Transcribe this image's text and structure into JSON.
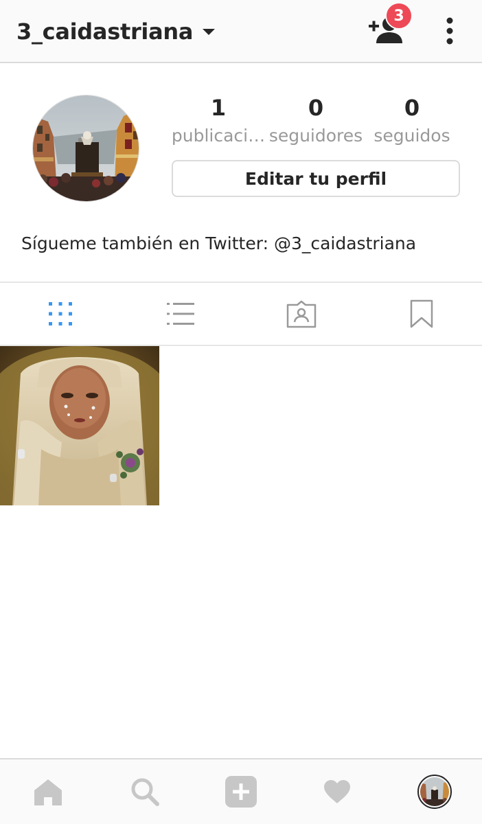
{
  "header": {
    "username": "3_caidastriana",
    "notification_count": "3",
    "icons": [
      "chevron-down-icon",
      "add-user-icon",
      "more-vertical-icon"
    ]
  },
  "profile": {
    "stats": [
      {
        "value": "1",
        "label": "publicaciones",
        "label_display": "publicaci…"
      },
      {
        "value": "0",
        "label": "seguidores"
      },
      {
        "value": "0",
        "label": "seguidos"
      }
    ],
    "edit_label": "Editar tu perfil",
    "bio": "Sígueme también en Twitter: @3_caidastriana"
  },
  "tabs": [
    {
      "icon": "grid-icon",
      "active": true
    },
    {
      "icon": "list-icon",
      "active": false
    },
    {
      "icon": "tagged-icon",
      "active": false
    },
    {
      "icon": "bookmark-icon",
      "active": false
    }
  ],
  "posts": [
    {
      "icon": "post-image"
    }
  ],
  "bottom_nav": [
    {
      "icon": "home-icon"
    },
    {
      "icon": "search-icon"
    },
    {
      "icon": "add-post-icon"
    },
    {
      "icon": "heart-icon"
    },
    {
      "icon": "profile-avatar"
    }
  ],
  "colors": {
    "accent": "#3897f0",
    "badge": "#ed4956",
    "text": "#262626",
    "secondary_text": "#999999",
    "nav_icon": "#c7c7c7",
    "border": "#dbdbdb"
  }
}
